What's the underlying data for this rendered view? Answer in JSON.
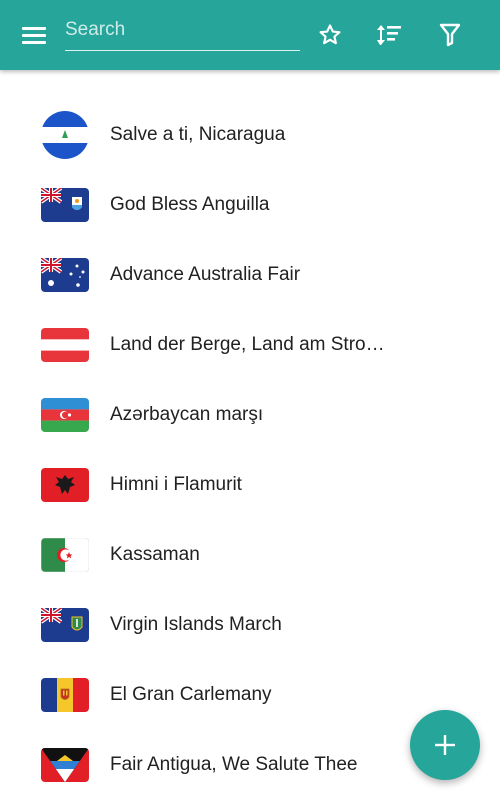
{
  "appbar": {
    "search_placeholder": "Search",
    "search_value": "",
    "icons": [
      "menu-icon",
      "star-icon",
      "sort-icon",
      "filter-icon"
    ],
    "color": "#26a69a"
  },
  "anthems": [
    {
      "title": "Salve a ti, Nicaragua",
      "flag": "nicaragua"
    },
    {
      "title": "God Bless Anguilla",
      "flag": "anguilla"
    },
    {
      "title": "Advance Australia Fair",
      "flag": "australia"
    },
    {
      "title": "Land der Berge, Land am Stro…",
      "flag": "austria"
    },
    {
      "title": "Azərbaycan marşı",
      "flag": "azerbaijan"
    },
    {
      "title": "Himni i Flamurit",
      "flag": "albania"
    },
    {
      "title": "Kassaman",
      "flag": "algeria"
    },
    {
      "title": "Virgin Islands March",
      "flag": "british-virgin-islands"
    },
    {
      "title": "El Gran Carlemany",
      "flag": "andorra"
    },
    {
      "title": "Fair Antigua, We Salute Thee",
      "flag": "antigua-and-barbuda"
    }
  ],
  "fab": {
    "icon": "plus-icon"
  }
}
